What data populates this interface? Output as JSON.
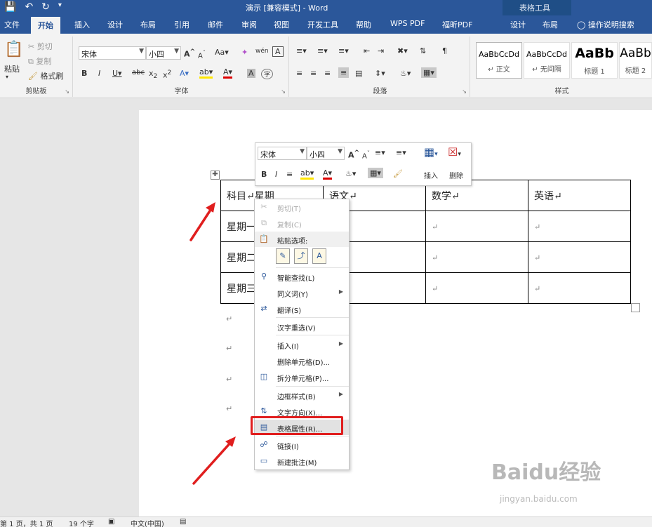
{
  "window": {
    "title": "演示 [兼容模式] - Word",
    "context_group": "表格工具",
    "qat_icons": [
      "save-icon",
      "undo-icon",
      "redo-icon",
      "customize-icon"
    ]
  },
  "tabs": [
    "文件",
    "开始",
    "插入",
    "设计",
    "布局",
    "引用",
    "邮件",
    "审阅",
    "视图",
    "开发工具",
    "帮助",
    "WPS PDF",
    "福昕PDF",
    "设计",
    "布局"
  ],
  "active_tab": "开始",
  "tell_me": "操作说明搜索",
  "ribbon": {
    "clipboard": {
      "label": "剪贴板",
      "paste": "粘贴",
      "cut": "剪切",
      "copy": "复制",
      "format_painter": "格式刷"
    },
    "font": {
      "label": "字体",
      "font_name": "宋体",
      "font_size": "小四"
    },
    "paragraph": {
      "label": "段落"
    },
    "styles": {
      "label": "样式",
      "cards": [
        {
          "sample": "AaBbCcDd",
          "name": "↵ 正文"
        },
        {
          "sample": "AaBbCcDd",
          "name": "↵ 无间隔"
        },
        {
          "sample": "AaBb",
          "name": "标题 1"
        },
        {
          "sample": "AaBb",
          "name": "标题 2"
        }
      ]
    }
  },
  "mini_toolbar": {
    "font_name": "宋体",
    "font_size": "小四",
    "insert": "插入",
    "delete": "删除"
  },
  "table": {
    "header": [
      "科目↵星期",
      "语文↵",
      "数学↵",
      "英语↵"
    ],
    "rows": [
      [
        "星期一",
        "↵",
        "↵",
        "↵"
      ],
      [
        "星期二",
        "↵",
        "↵",
        "↵"
      ],
      [
        "星期三",
        "↵",
        "↵",
        "↵"
      ]
    ]
  },
  "paragraph_marks": [
    "↵",
    "↵",
    "↵",
    "↵"
  ],
  "context_menu": {
    "items": [
      {
        "label": "剪切(T)",
        "icon": "cut-icon",
        "disabled": true
      },
      {
        "label": "复制(C)",
        "icon": "copy-icon",
        "disabled": true
      },
      {
        "label": "粘贴选项:",
        "icon": "paste-icon",
        "header": true
      },
      {
        "label": "智能查找(L)",
        "icon": "smart-lookup-icon"
      },
      {
        "label": "同义词(Y)",
        "icon": "",
        "submenu": true
      },
      {
        "label": "翻译(S)",
        "icon": "translate-icon"
      },
      {
        "label": "汉字重选(V)",
        "icon": ""
      },
      {
        "label": "插入(I)",
        "icon": "",
        "submenu": true
      },
      {
        "label": "删除单元格(D)...",
        "icon": ""
      },
      {
        "label": "拆分单元格(P)...",
        "icon": "split-cells-icon"
      },
      {
        "label": "边框样式(B)",
        "icon": "",
        "submenu": true
      },
      {
        "label": "文字方向(X)...",
        "icon": "text-direction-icon"
      },
      {
        "label": "表格属性(R)...",
        "icon": "table-properties-icon",
        "highlight": true
      },
      {
        "label": "链接(I)",
        "icon": "link-icon"
      },
      {
        "label": "新建批注(M)",
        "icon": "comment-icon"
      }
    ]
  },
  "status_bar": {
    "page": "第 1 页，共 1 页",
    "words": "19 个字",
    "language": "中文(中国)"
  },
  "watermark": {
    "logo": "Baidu经验",
    "url": "jingyan.baidu.com"
  },
  "accent_colors": {
    "title_bar": "#2b579a",
    "highlight": "#e01e1e"
  }
}
